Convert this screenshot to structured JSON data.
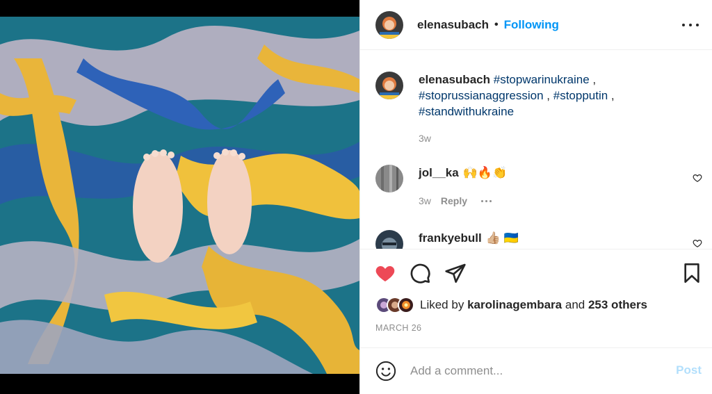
{
  "post": {
    "author": "elenasubach",
    "separator": "•",
    "follow_label": "Following"
  },
  "caption": {
    "username": "elenasubach",
    "tags": [
      "#stopwarinukraine",
      "#stoprussianaggression",
      "#stopputin",
      "#standwithukraine"
    ],
    "sep": " , ",
    "time": "3w"
  },
  "comments": [
    {
      "username": "jol__ka",
      "text": "🙌🔥👏",
      "time": "3w",
      "reply_label": "Reply"
    },
    {
      "username": "frankyebull",
      "text": "👍🏼 🇺🇦"
    }
  ],
  "likes": {
    "prefix": "Liked by",
    "user": "karolinagembara",
    "and": "and",
    "others": "253 others"
  },
  "date": "MARCH 26",
  "add_comment": {
    "placeholder": "Add a comment...",
    "post_label": "Post"
  },
  "colors": {
    "accent": "#0095f6",
    "heart": "#ed4956",
    "post_disabled": "#b2dffc",
    "hashtag": "#00376b"
  },
  "icons": [
    "heart-icon",
    "comment-icon",
    "share-icon",
    "bookmark-icon",
    "emoji-icon",
    "more-icon"
  ]
}
